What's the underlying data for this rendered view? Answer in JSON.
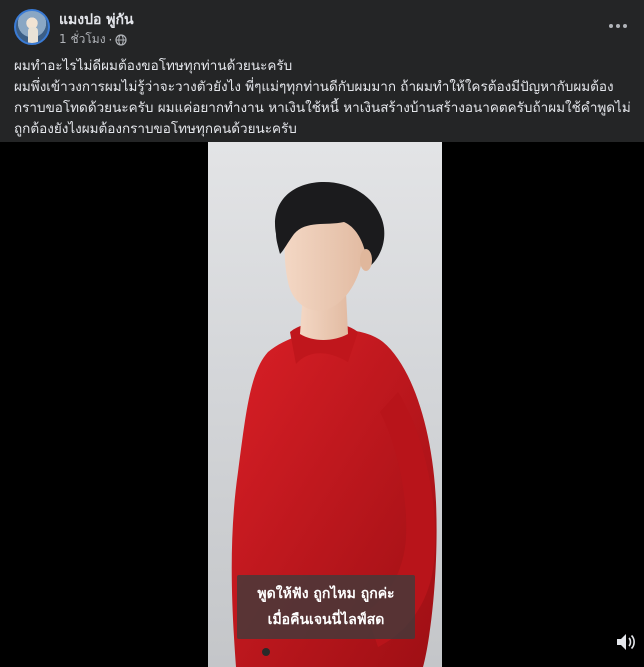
{
  "post": {
    "author": "แมงปอ พู่กัน",
    "time": "1 ชั่วโมง",
    "separator": "·",
    "privacy_icon": "globe-icon",
    "more_icon": "more-icon",
    "text_lines": [
      "ผมทำอะไรไม่ดีผมต้องขอโทษทุกท่านด้วยนะครับ",
      "ผมพึ่งเข้าวงการผมไม่รู้ว่าจะวางตัวยังไง พี่ๆแม่ๆทุกท่านดีกับผมมาก ถ้าผมทำให้ใครต้องมีปัญหากับผมต้อง",
      "กราบขอโทดด้วยนะครับ ผมแค่อยากทำงาน หาเงินใช้หนี้ หาเงินสร้างบ้านสร้างอนาคตครับถ้าผมใช้คำพูดไม่",
      "ถูกต้องยังไงผมต้องกราบขอโทษทุกคนด้วยนะครับ"
    ]
  },
  "video": {
    "caption_line1": "พูดให้ฟัง ถูกไหม ถูกค่ะ",
    "caption_line2": "เมื่อคืนเจนนี่ไลฟ์สด",
    "volume_icon": "volume-icon",
    "colors": {
      "jacket": "#c8161d",
      "backdrop": "#d4d6d9",
      "letterbox": "#000000"
    }
  },
  "theme": {
    "background": "#242526",
    "text": "#e4e6eb",
    "secondary_text": "#b0b3b8"
  }
}
